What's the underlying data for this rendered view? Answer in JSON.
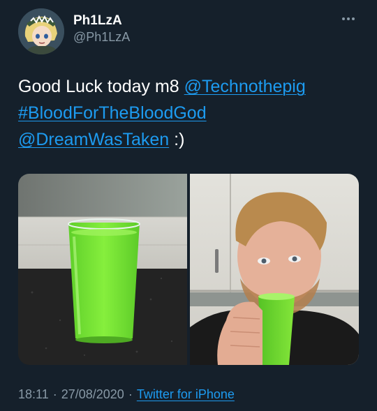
{
  "author": {
    "name": "Ph1LzA",
    "handle": "@Ph1LzA"
  },
  "tweet": {
    "text_start": "Good Luck today m8 ",
    "mention_1": "@Technothepig",
    "hashtag": "#BloodForTheBloodGod",
    "mention_2": "@DreamWasTaken",
    "text_end": " :)"
  },
  "footer": {
    "time": "18:11",
    "separator": "·",
    "date": "27/08/2020",
    "source": "Twitter for iPhone"
  },
  "icons": {
    "more": "more-options-icon"
  },
  "colors": {
    "background": "#15202b",
    "link": "#1d9bf0",
    "secondary_text": "#8899a6"
  }
}
